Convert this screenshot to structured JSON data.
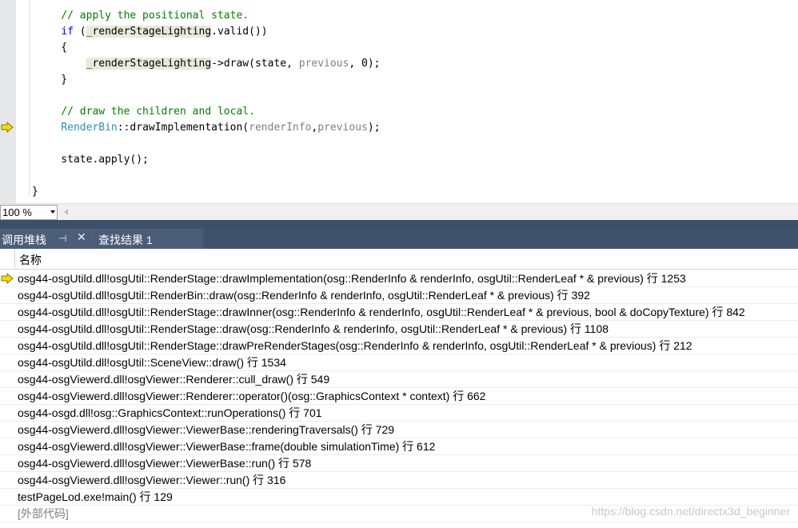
{
  "editor": {
    "lines": [
      {
        "parts": [
          {
            "t": "    // apply the positional state.",
            "c": "cm"
          }
        ]
      },
      {
        "parts": [
          {
            "t": "    ",
            "c": ""
          },
          {
            "t": "if",
            "c": "kw"
          },
          {
            "t": " (",
            "c": ""
          },
          {
            "t": "_renderStageLighting",
            "c": "hl"
          },
          {
            "t": ".valid())",
            "c": ""
          }
        ]
      },
      {
        "parts": [
          {
            "t": "    {",
            "c": ""
          }
        ]
      },
      {
        "parts": [
          {
            "t": "        ",
            "c": ""
          },
          {
            "t": "_renderStageLighting",
            "c": "hl"
          },
          {
            "t": "->draw(state, ",
            "c": ""
          },
          {
            "t": "previous",
            "c": "pm"
          },
          {
            "t": ", 0);",
            "c": ""
          }
        ]
      },
      {
        "parts": [
          {
            "t": "    }",
            "c": ""
          }
        ]
      },
      {
        "parts": [
          {
            "t": "",
            "c": ""
          }
        ]
      },
      {
        "parts": [
          {
            "t": "    // draw the children and local.",
            "c": "cm"
          }
        ]
      },
      {
        "parts": [
          {
            "t": "    ",
            "c": ""
          },
          {
            "t": "RenderBin",
            "c": "ty"
          },
          {
            "t": "::drawImplementation(",
            "c": ""
          },
          {
            "t": "renderInfo",
            "c": "pm"
          },
          {
            "t": ",",
            "c": ""
          },
          {
            "t": "previous",
            "c": "pm"
          },
          {
            "t": ");",
            "c": ""
          }
        ]
      },
      {
        "parts": [
          {
            "t": "",
            "c": ""
          }
        ]
      },
      {
        "parts": [
          {
            "t": "    state.apply();",
            "c": ""
          }
        ]
      },
      {
        "parts": [
          {
            "t": "",
            "c": ""
          }
        ]
      },
      {
        "parts": [
          {
            "t": "}",
            "c": ""
          }
        ]
      }
    ],
    "current_line_index": 7
  },
  "zoom": {
    "value": "100 %"
  },
  "tabs": [
    {
      "label": "调用堆栈",
      "active": true
    },
    {
      "label": "查找结果 1",
      "active": false
    }
  ],
  "tab_icons": {
    "pin": "pin-icon",
    "close": "close-icon"
  },
  "call_stack": {
    "column_header": "名称",
    "rows": [
      {
        "text": "osg44-osgUtild.dll!osgUtil::RenderStage::drawImplementation(osg::RenderInfo & renderInfo, osgUtil::RenderLeaf * & previous) 行 1253",
        "current": true
      },
      {
        "text": "osg44-osgUtild.dll!osgUtil::RenderBin::draw(osg::RenderInfo & renderInfo, osgUtil::RenderLeaf * & previous) 行 392",
        "current": false
      },
      {
        "text": "osg44-osgUtild.dll!osgUtil::RenderStage::drawInner(osg::RenderInfo & renderInfo, osgUtil::RenderLeaf * & previous, bool & doCopyTexture) 行 842",
        "current": false
      },
      {
        "text": "osg44-osgUtild.dll!osgUtil::RenderStage::draw(osg::RenderInfo & renderInfo, osgUtil::RenderLeaf * & previous) 行 1108",
        "current": false
      },
      {
        "text": "osg44-osgUtild.dll!osgUtil::RenderStage::drawPreRenderStages(osg::RenderInfo & renderInfo, osgUtil::RenderLeaf * & previous) 行 212",
        "current": false
      },
      {
        "text": "osg44-osgUtild.dll!osgUtil::SceneView::draw() 行 1534",
        "current": false
      },
      {
        "text": "osg44-osgViewerd.dll!osgViewer::Renderer::cull_draw() 行 549",
        "current": false
      },
      {
        "text": "osg44-osgViewerd.dll!osgViewer::Renderer::operator()(osg::GraphicsContext * context) 行 662",
        "current": false
      },
      {
        "text": "osg44-osgd.dll!osg::GraphicsContext::runOperations() 行 701",
        "current": false
      },
      {
        "text": "osg44-osgViewerd.dll!osgViewer::ViewerBase::renderingTraversals() 行 729",
        "current": false
      },
      {
        "text": "osg44-osgViewerd.dll!osgViewer::ViewerBase::frame(double simulationTime) 行 612",
        "current": false
      },
      {
        "text": "osg44-osgViewerd.dll!osgViewer::ViewerBase::run() 行 578",
        "current": false
      },
      {
        "text": "osg44-osgViewerd.dll!osgViewer::Viewer::run() 行 316",
        "current": false
      },
      {
        "text": "testPageLod.exe!main() 行 129",
        "current": false
      },
      {
        "text": "[外部代码]",
        "current": false,
        "external": true
      }
    ]
  },
  "watermark": "https://blog.csdn.net/directx3d_beginner",
  "colors": {
    "tab_strip": "#3d4f69",
    "keyword": "#0000ff",
    "comment": "#008000",
    "type": "#2b91af",
    "exec_arrow": "#f5d90a"
  }
}
